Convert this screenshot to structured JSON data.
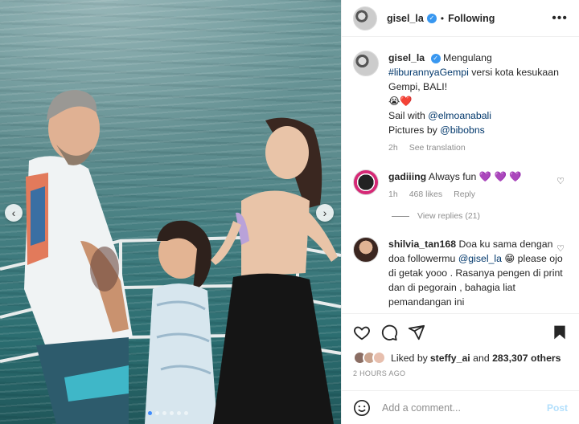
{
  "post": {
    "author": "gisel_la",
    "separator": "•",
    "follow_status": "Following",
    "more_icon": "more-horizontal-icon"
  },
  "caption": {
    "username": "gisel_la",
    "line1": "Mengulang",
    "hashtag": "#liburannyaGempi",
    "line1_rest": " versi kota kesukaan Gempi, BALI!",
    "emojis": "😭❤️",
    "sail_prefix": "Sail with ",
    "sail_mention": "@elmoanabali",
    "pictures_prefix": "Pictures by ",
    "pictures_mention": "@bibobns",
    "age": "2h",
    "see_translation": "See translation"
  },
  "comments": [
    {
      "username": "gadiiing",
      "text": "Always fun 💜 💜 💜",
      "age": "1h",
      "likes": "468 likes",
      "reply": "Reply",
      "view_replies": "View replies (21)"
    },
    {
      "username": "shilvia_tan168",
      "text_before": "Doa ku sama dengan doa followermu ",
      "mention": "@gisel_la",
      "text_after": " 😁 please ojo di getak yooo . Rasanya pengen di print dan di pegorain , bahagia liat pemandangan ini"
    }
  ],
  "likes": {
    "prefix": "Liked by ",
    "liker": "steffy_ai",
    "middle": " and ",
    "count": "283,307 others"
  },
  "timestamp": "2 HOURS AGO",
  "add_comment": {
    "placeholder": "Add a comment...",
    "post_label": "Post"
  },
  "carousel": {
    "prev": "‹",
    "next": "›",
    "slide_count": 6,
    "active_slide": 1
  },
  "colors": {
    "link": "#00376b",
    "verified": "#3897f0",
    "post_disabled": "#b2dffc",
    "active_dot": "#3d8bfd"
  }
}
